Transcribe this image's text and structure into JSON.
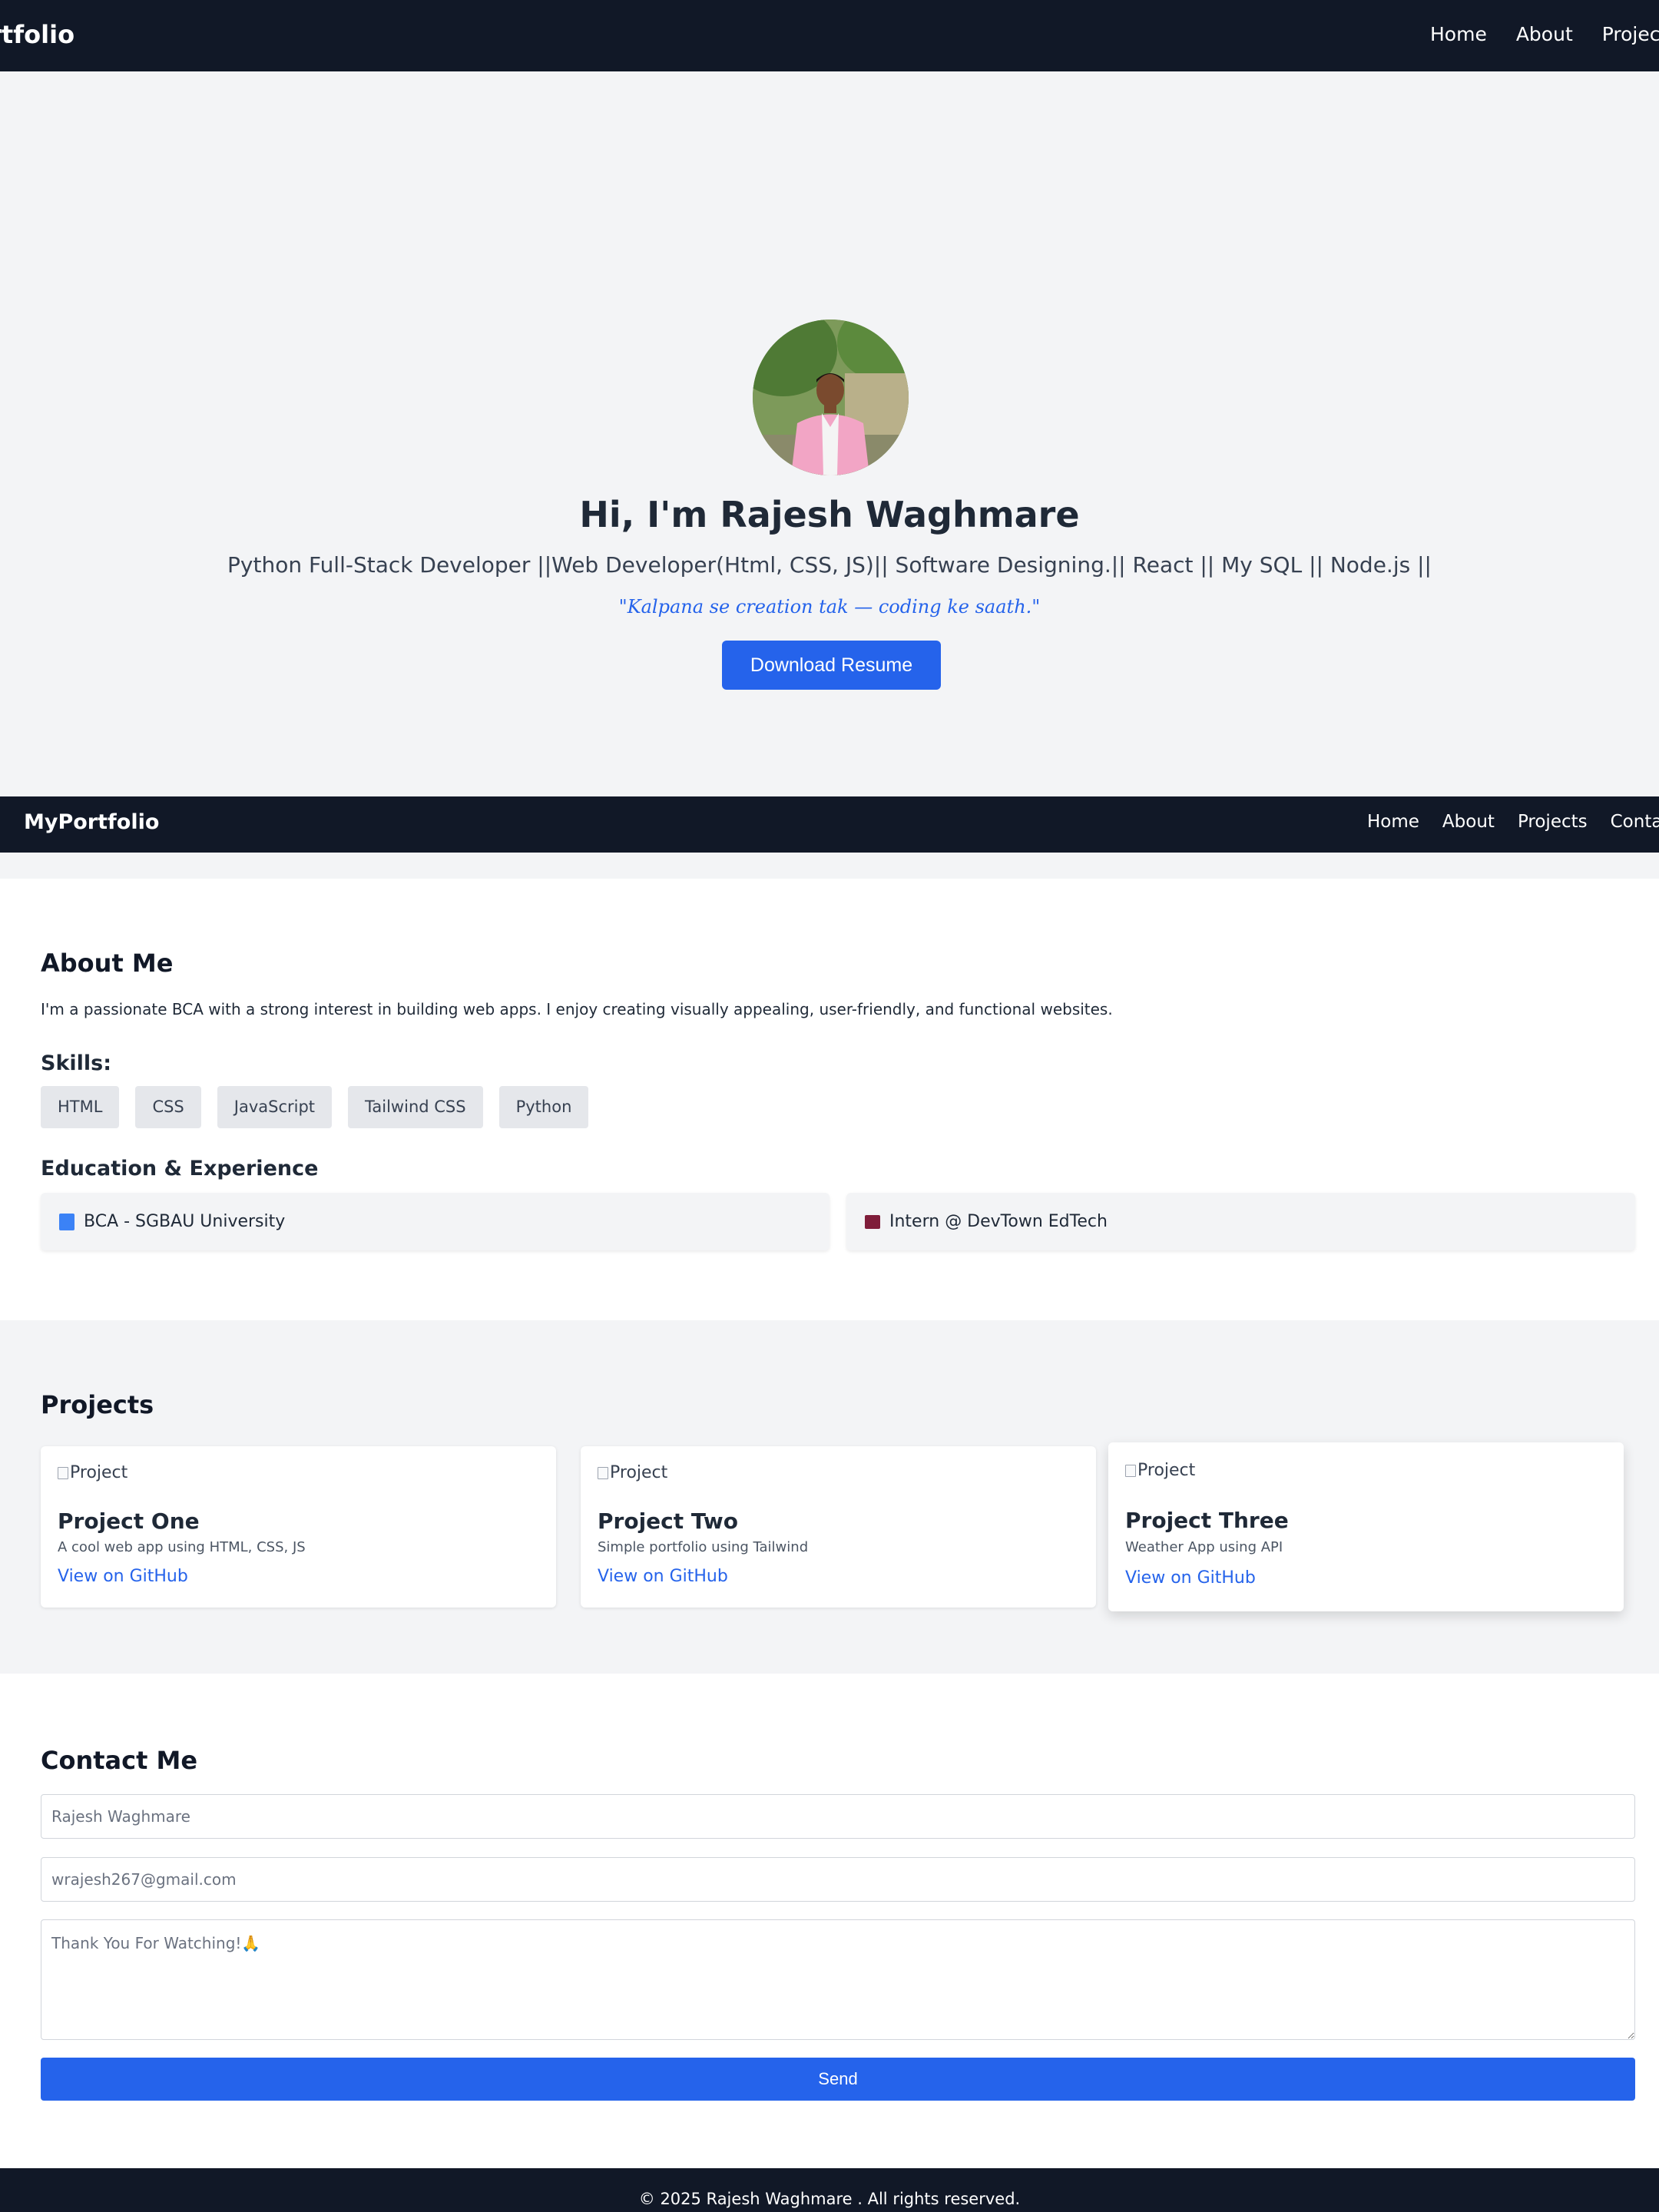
{
  "top_nav": {
    "brand": "MyPortfolio",
    "links": [
      "Home",
      "About",
      "Projects"
    ]
  },
  "hero": {
    "title": "Hi, I'm Rajesh Waghmare",
    "subtitle": "Python Full-Stack Developer ||Web Developer(Html, CSS, JS)|| Software Designing.|| React || My SQL || Node.js ||",
    "quote": "\"Kalpana se creation tak — coding ke saath.\"",
    "button": "Download Resume"
  },
  "nav": {
    "brand": "MyPortfolio",
    "links": [
      "Home",
      "About",
      "Projects",
      "Contact"
    ]
  },
  "about": {
    "title": "About Me",
    "text": "I'm a passionate BCA with a strong interest in building web apps. I enjoy creating visually appealing, user-friendly, and functional websites.",
    "skills_title": "Skills:",
    "skills": [
      "HTML",
      "CSS",
      "JavaScript",
      "Tailwind CSS",
      "Python"
    ],
    "education_title": "Education & Experience",
    "education": [
      {
        "icon": "book-icon",
        "text": "BCA - SGBAU University"
      },
      {
        "icon": "briefcase-icon",
        "text": "Intern @ DevTown EdTech"
      }
    ]
  },
  "projects": {
    "title": "Projects",
    "items": [
      {
        "img_alt": "Project",
        "name": "Project One",
        "desc": "A cool web app using HTML, CSS, JS",
        "link": "View on GitHub"
      },
      {
        "img_alt": "Project",
        "name": "Project Two",
        "desc": "Simple portfolio using Tailwind",
        "link": "View on GitHub"
      },
      {
        "img_alt": "Project",
        "name": "Project Three",
        "desc": "Weather App using API",
        "link": "View on GitHub"
      }
    ]
  },
  "contact": {
    "title": "Contact Me",
    "name_placeholder": "Rajesh Waghmare",
    "email_placeholder": "wrajesh267@gmail.com",
    "message_placeholder": "Thank You For Watching!🙏",
    "send": "Send"
  },
  "footer": {
    "text": "© 2025 Rajesh Waghmare . All rights reserved."
  },
  "colors": {
    "navbar": "#111827",
    "accent": "#2563eb",
    "section_bg": "#f3f4f6",
    "skill_bg": "#e5e7eb"
  }
}
